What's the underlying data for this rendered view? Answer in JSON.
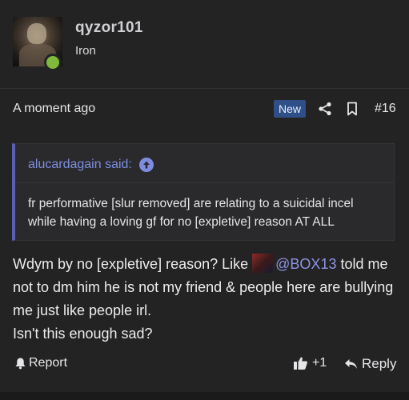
{
  "user": {
    "name": "qyzor101",
    "title": "Iron",
    "online_color": "#7fba3a"
  },
  "post": {
    "time": "A moment ago",
    "badge": "New",
    "number": "#16",
    "icons": [
      "share-icon",
      "bookmark-icon"
    ]
  },
  "quote": {
    "author": "alucardagain said:",
    "text": "fr performative [slur removed] are relating to a suicidal incel while having a loving gf for no [expletive] reason AT ALL"
  },
  "message": {
    "line1_a": "Wdym by no [expletive] reason? Like ",
    "mention": "@BOX13",
    "line1_b": " told me not to dm him he is not my friend & people here are bullying me just like people irl.",
    "line2": "Isn't this enough sad?"
  },
  "footer": {
    "report": "Report",
    "likes": "+1",
    "reply": "Reply"
  },
  "colors": {
    "accent": "#7e8de0",
    "badge": "#2e4f87",
    "background": "#232324"
  }
}
